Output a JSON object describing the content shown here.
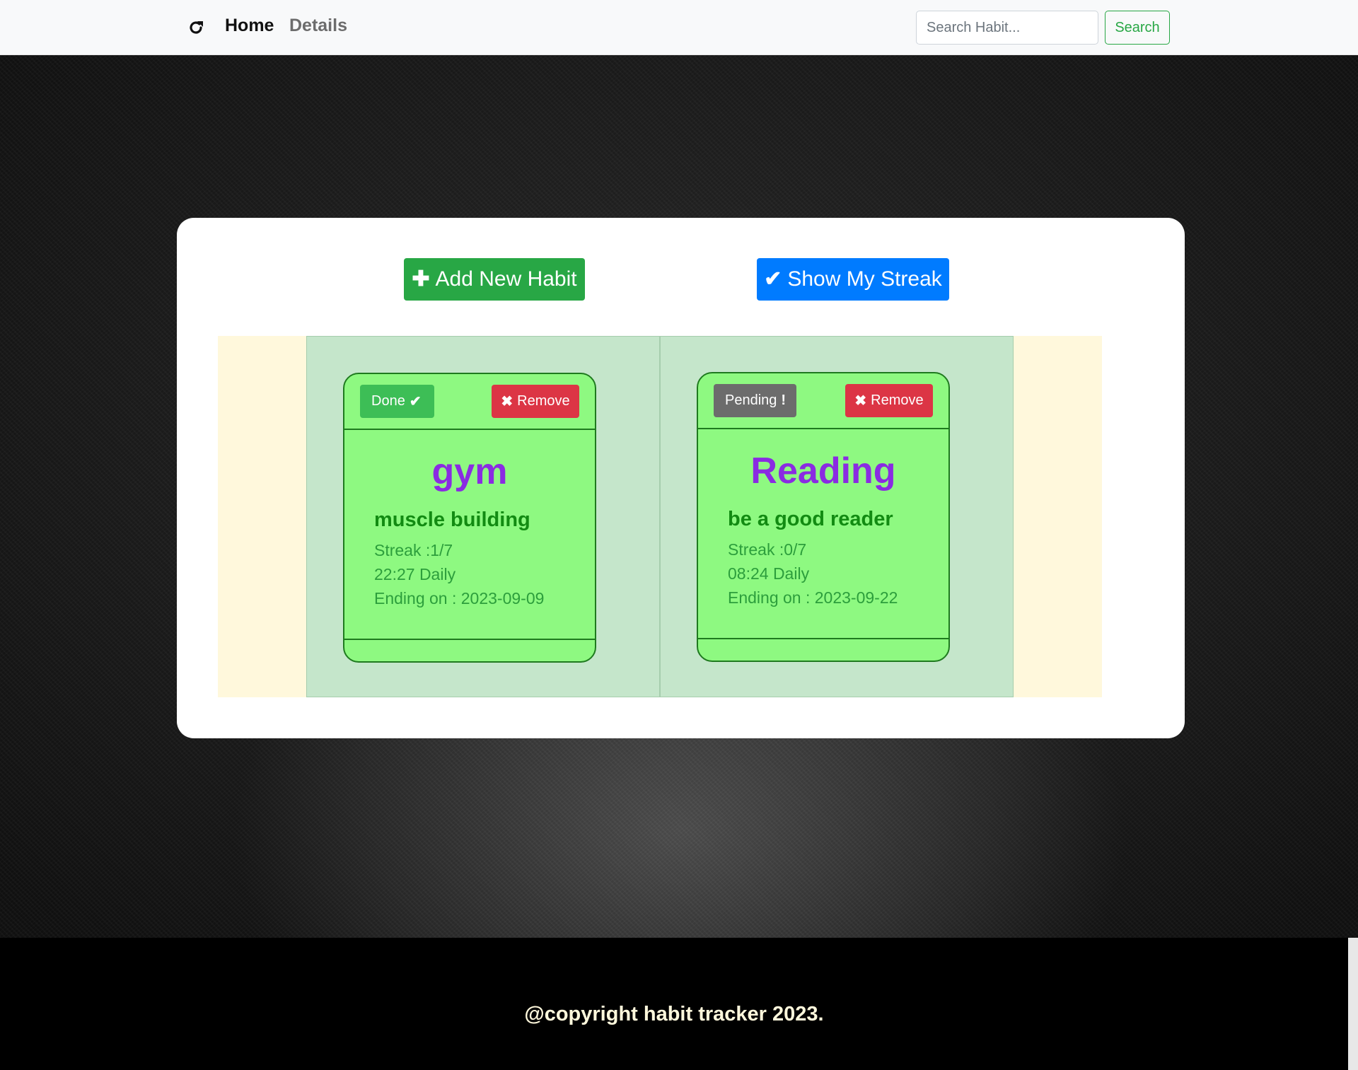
{
  "navbar": {
    "refresh_icon": "refresh-icon",
    "home_label": "Home",
    "details_label": "Details",
    "search_placeholder": "Search Habit...",
    "search_button_label": "Search"
  },
  "actions": {
    "add_label": "Add New Habit",
    "add_icon": "plus-icon",
    "streak_label": "Show My Streak",
    "streak_icon": "check-icon"
  },
  "habits": [
    {
      "status_label": "Done",
      "status_icon": "check-icon",
      "remove_label": "Remove",
      "title": "gym",
      "description": "muscle building",
      "streak": "Streak :1/7",
      "schedule": "22:27 Daily",
      "ending": "Ending on : 2023-09-09"
    },
    {
      "status_label": "Pending",
      "status_icon": "exclamation-icon",
      "remove_label": "Remove",
      "title": "Reading",
      "description": "be a good reader",
      "streak": "Streak :0/7",
      "schedule": "08:24 Daily",
      "ending": "Ending on : 2023-09-22"
    }
  ],
  "footer": {
    "text": "@copyright habit tracker 2023."
  },
  "colors": {
    "primary": "#007bff",
    "success": "#28a745",
    "danger": "#dc3545",
    "card_bg": "#8ef981",
    "title_purple": "#8a2be2"
  }
}
